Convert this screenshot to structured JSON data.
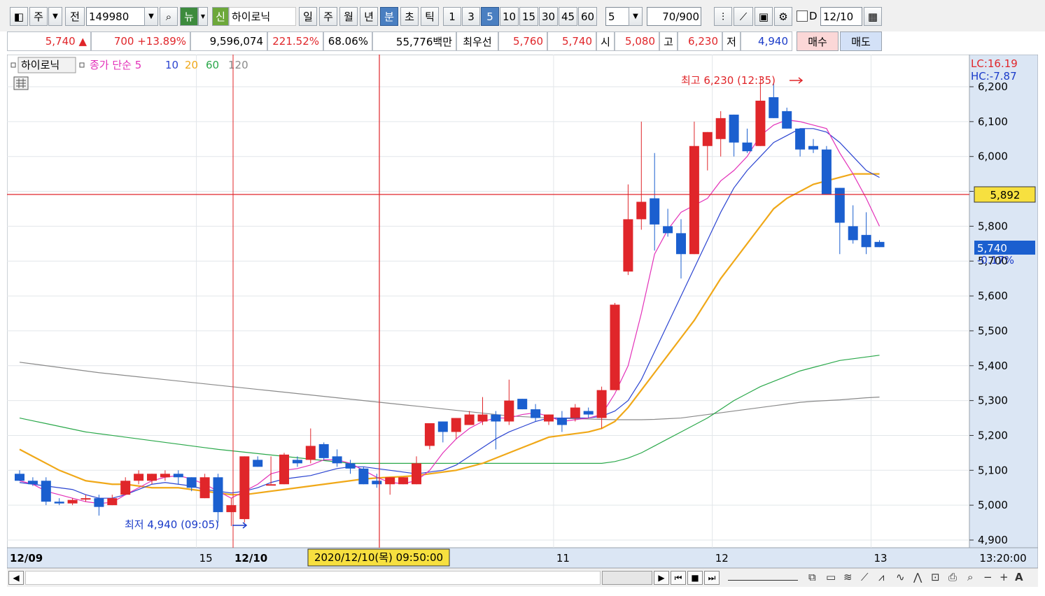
{
  "toolbar": {
    "period_type": "주",
    "prev_label": "전",
    "code": "149980",
    "news_label": "뉴",
    "new_label": "신",
    "stock_name": "하이로닉",
    "periods": [
      "일",
      "주",
      "월",
      "년",
      "분",
      "초",
      "틱"
    ],
    "selected_period": "분",
    "intervals": [
      "1",
      "3",
      "5",
      "10",
      "15",
      "30",
      "45",
      "60"
    ],
    "selected_interval": "5",
    "interval_select": "5",
    "count": "70",
    "count_total": "/900",
    "d_label": "D",
    "date": "12/10"
  },
  "quote": {
    "price": "5,740",
    "change": "700",
    "change_pct": "+13.89%",
    "volume": "9,596,074",
    "vol_ratio": "221.52%",
    "turnover": "68.06%",
    "amount": "55,776백만",
    "best_label": "최우선",
    "ask": "5,760",
    "bid": "5,740",
    "open_label": "시",
    "open": "5,080",
    "high_label": "고",
    "high": "6,230",
    "low_label": "저",
    "low": "4,940",
    "buy_label": "매수",
    "sell_label": "매도"
  },
  "colors": {
    "up": "#e0262a",
    "down": "#1b5fcf",
    "ma5": "#e331b9",
    "ma10": "#2b44d1",
    "ma20": "#f0a818",
    "ma60": "#2aa84a",
    "ma120": "#8a8a8a",
    "crosshair": "#e0262a",
    "right_panel": "#dbe6f4"
  },
  "legend": {
    "name": "하이로닉",
    "ma_label": "종가 단순",
    "periods": [
      "5",
      "10",
      "20",
      "60",
      "120"
    ]
  },
  "right_axis": {
    "lc": "LC:16.19",
    "hc": "HC:-7.87",
    "crosshair_value": "5,892",
    "last_price": "5,740",
    "last_change": "-0.17%"
  },
  "annotations": {
    "high": "최고 6,230 (12:35)",
    "low": "최저 4,940 (09:05)"
  },
  "x_axis": {
    "labels": [
      "12/09",
      "15",
      "12/10",
      "11",
      "12",
      "13"
    ],
    "crosshair_time": "2020/12/10(목) 09:50:00",
    "right_time": "13:20:00"
  },
  "chart_data": {
    "type": "candlestick",
    "ylim": [
      4900,
      6230
    ],
    "yticks": [
      4900,
      5000,
      5100,
      5200,
      5300,
      5400,
      5500,
      5600,
      5700,
      5800,
      5900,
      6000,
      6100,
      6200
    ],
    "ytick_labels": [
      "4,900",
      "5,000",
      "5,100",
      "5,200",
      "5,300",
      "5,400",
      "5,500",
      "5,600",
      "5,700",
      "5,800",
      "5,900",
      "6,000",
      "6,100",
      "6,200"
    ],
    "candles": [
      {
        "o": 5090,
        "h": 5100,
        "l": 5070,
        "c": 5070
      },
      {
        "o": 5070,
        "h": 5080,
        "l": 5055,
        "c": 5060
      },
      {
        "o": 5070,
        "h": 5080,
        "l": 5000,
        "c": 5010
      },
      {
        "o": 5010,
        "h": 5020,
        "l": 5000,
        "c": 5005
      },
      {
        "o": 5005,
        "h": 5020,
        "l": 5000,
        "c": 5015
      },
      {
        "o": 5020,
        "h": 5030,
        "l": 5010,
        "c": 5020
      },
      {
        "o": 5020,
        "h": 5030,
        "l": 4970,
        "c": 4995
      },
      {
        "o": 5000,
        "h": 5030,
        "l": 5000,
        "c": 5020
      },
      {
        "o": 5030,
        "h": 5080,
        "l": 5030,
        "c": 5070
      },
      {
        "o": 5070,
        "h": 5100,
        "l": 5060,
        "c": 5090
      },
      {
        "o": 5070,
        "h": 5090,
        "l": 5060,
        "c": 5090
      },
      {
        "o": 5080,
        "h": 5100,
        "l": 5070,
        "c": 5090
      },
      {
        "o": 5090,
        "h": 5100,
        "l": 5060,
        "c": 5080
      },
      {
        "o": 5080,
        "h": 5080,
        "l": 5040,
        "c": 5050
      },
      {
        "o": 5020,
        "h": 5090,
        "l": 5020,
        "c": 5080
      },
      {
        "o": 5080,
        "h": 5090,
        "l": 4950,
        "c": 4980
      },
      {
        "o": 4980,
        "h": 5020,
        "l": 4940,
        "c": 5000
      },
      {
        "o": 4960,
        "h": 5140,
        "l": 4950,
        "c": 5140
      },
      {
        "o": 5130,
        "h": 5140,
        "l": 5110,
        "c": 5110
      },
      {
        "o": 5060,
        "h": 5140,
        "l": 5060,
        "c": 5060
      },
      {
        "o": 5060,
        "h": 5150,
        "l": 5060,
        "c": 5145
      },
      {
        "o": 5130,
        "h": 5140,
        "l": 5110,
        "c": 5120
      },
      {
        "o": 5130,
        "h": 5220,
        "l": 5120,
        "c": 5170
      },
      {
        "o": 5175,
        "h": 5180,
        "l": 5130,
        "c": 5135
      },
      {
        "o": 5140,
        "h": 5160,
        "l": 5110,
        "c": 5120
      },
      {
        "o": 5120,
        "h": 5130,
        "l": 5090,
        "c": 5105
      },
      {
        "o": 5105,
        "h": 5110,
        "l": 5060,
        "c": 5060
      },
      {
        "o": 5070,
        "h": 5090,
        "l": 5050,
        "c": 5060
      },
      {
        "o": 5060,
        "h": 5070,
        "l": 5030,
        "c": 5080
      },
      {
        "o": 5060,
        "h": 5080,
        "l": 5060,
        "c": 5080
      },
      {
        "o": 5060,
        "h": 5140,
        "l": 5060,
        "c": 5120
      },
      {
        "o": 5170,
        "h": 5200,
        "l": 5160,
        "c": 5235
      },
      {
        "o": 5240,
        "h": 5230,
        "l": 5180,
        "c": 5210
      },
      {
        "o": 5210,
        "h": 5230,
        "l": 5190,
        "c": 5250
      },
      {
        "o": 5230,
        "h": 5270,
        "l": 5230,
        "c": 5260
      },
      {
        "o": 5240,
        "h": 5310,
        "l": 5230,
        "c": 5260
      },
      {
        "o": 5260,
        "h": 5270,
        "l": 5160,
        "c": 5240
      },
      {
        "o": 5240,
        "h": 5360,
        "l": 5230,
        "c": 5300
      },
      {
        "o": 5305,
        "h": 5300,
        "l": 5280,
        "c": 5275
      },
      {
        "o": 5275,
        "h": 5290,
        "l": 5240,
        "c": 5250
      },
      {
        "o": 5240,
        "h": 5260,
        "l": 5230,
        "c": 5260
      },
      {
        "o": 5250,
        "h": 5270,
        "l": 5210,
        "c": 5230
      },
      {
        "o": 5250,
        "h": 5290,
        "l": 5240,
        "c": 5280
      },
      {
        "o": 5270,
        "h": 5280,
        "l": 5250,
        "c": 5260
      },
      {
        "o": 5250,
        "h": 5340,
        "l": 5220,
        "c": 5330
      },
      {
        "o": 5330,
        "h": 5580,
        "l": 5330,
        "c": 5575
      },
      {
        "o": 5670,
        "h": 5920,
        "l": 5660,
        "c": 5820
      },
      {
        "o": 5820,
        "h": 6100,
        "l": 5790,
        "c": 5870
      },
      {
        "o": 5880,
        "h": 6010,
        "l": 5730,
        "c": 5805
      },
      {
        "o": 5800,
        "h": 5850,
        "l": 5770,
        "c": 5780
      },
      {
        "o": 5780,
        "h": 5820,
        "l": 5650,
        "c": 5720
      },
      {
        "o": 5720,
        "h": 6100,
        "l": 5720,
        "c": 6030
      },
      {
        "o": 6030,
        "h": 6070,
        "l": 5960,
        "c": 6070
      },
      {
        "o": 6050,
        "h": 6130,
        "l": 6000,
        "c": 6110
      },
      {
        "o": 6120,
        "h": 6120,
        "l": 6000,
        "c": 6040
      },
      {
        "o": 6040,
        "h": 6080,
        "l": 6010,
        "c": 6015
      },
      {
        "o": 6030,
        "h": 6230,
        "l": 6030,
        "c": 6160
      },
      {
        "o": 6170,
        "h": 6210,
        "l": 6110,
        "c": 6110
      },
      {
        "o": 6130,
        "h": 6140,
        "l": 6080,
        "c": 6080
      },
      {
        "o": 6080,
        "h": 6080,
        "l": 6000,
        "c": 6020
      },
      {
        "o": 6030,
        "h": 6050,
        "l": 6010,
        "c": 6020
      },
      {
        "o": 6020,
        "h": 6030,
        "l": 5890,
        "c": 5890
      },
      {
        "o": 5910,
        "h": 5900,
        "l": 5720,
        "c": 5810
      },
      {
        "o": 5800,
        "h": 5860,
        "l": 5750,
        "c": 5760
      },
      {
        "o": 5775,
        "h": 5840,
        "l": 5720,
        "c": 5740
      },
      {
        "o": 5755,
        "h": 5760,
        "l": 5740,
        "c": 5740
      }
    ],
    "ma5": [
      5070,
      5060,
      5040,
      5030,
      5020,
      5010,
      5005,
      5008,
      5030,
      5050,
      5070,
      5080,
      5085,
      5075,
      5060,
      5040,
      5020,
      5040,
      5060,
      5090,
      5100,
      5105,
      5115,
      5130,
      5130,
      5120,
      5100,
      5080,
      5065,
      5062,
      5070,
      5100,
      5150,
      5190,
      5220,
      5240,
      5250,
      5250,
      5260,
      5265,
      5255,
      5240,
      5245,
      5250,
      5260,
      5320,
      5400,
      5550,
      5720,
      5790,
      5840,
      5860,
      5880,
      5930,
      5960,
      6000,
      6060,
      6090,
      6105,
      6100,
      6090,
      6080,
      6010,
      5950,
      5880,
      5800
    ],
    "ma10": [
      5065,
      5060,
      5055,
      5050,
      5045,
      5030,
      5020,
      5020,
      5030,
      5045,
      5060,
      5065,
      5060,
      5055,
      5045,
      5040,
      5035,
      5040,
      5050,
      5065,
      5075,
      5080,
      5085,
      5095,
      5105,
      5110,
      5110,
      5105,
      5100,
      5095,
      5090,
      5095,
      5100,
      5115,
      5140,
      5165,
      5190,
      5210,
      5225,
      5240,
      5250,
      5250,
      5250,
      5250,
      5255,
      5270,
      5300,
      5360,
      5440,
      5520,
      5600,
      5680,
      5760,
      5840,
      5910,
      5960,
      6000,
      6040,
      6060,
      6080,
      6080,
      6070,
      6040,
      6000,
      5960,
      5940
    ],
    "ma20": [
      5160,
      5140,
      5120,
      5100,
      5085,
      5070,
      5065,
      5060,
      5060,
      5055,
      5050,
      5050,
      5050,
      5045,
      5040,
      5035,
      5030,
      5030,
      5035,
      5040,
      5045,
      5050,
      5055,
      5060,
      5065,
      5070,
      5075,
      5078,
      5080,
      5082,
      5085,
      5090,
      5095,
      5100,
      5110,
      5120,
      5135,
      5150,
      5165,
      5180,
      5195,
      5200,
      5205,
      5210,
      5220,
      5240,
      5280,
      5330,
      5380,
      5430,
      5480,
      5530,
      5590,
      5650,
      5700,
      5750,
      5800,
      5850,
      5880,
      5900,
      5920,
      5930,
      5940,
      5950,
      5950,
      5950
    ],
    "ma60": [
      5250,
      5242,
      5234,
      5226,
      5218,
      5210,
      5205,
      5200,
      5195,
      5190,
      5185,
      5180,
      5175,
      5170,
      5165,
      5160,
      5156,
      5152,
      5148,
      5144,
      5140,
      5136,
      5132,
      5128,
      5124,
      5120,
      5120,
      5120,
      5120,
      5120,
      5120,
      5120,
      5120,
      5120,
      5120,
      5120,
      5120,
      5120,
      5120,
      5120,
      5120,
      5120,
      5120,
      5120,
      5120,
      5125,
      5135,
      5150,
      5170,
      5190,
      5210,
      5230,
      5250,
      5275,
      5300,
      5320,
      5340,
      5355,
      5370,
      5385,
      5395,
      5405,
      5415,
      5420,
      5425,
      5430
    ],
    "ma120": [
      5410,
      5405,
      5400,
      5395,
      5390,
      5385,
      5380,
      5376,
      5372,
      5368,
      5364,
      5360,
      5356,
      5352,
      5348,
      5344,
      5340,
      5336,
      5332,
      5328,
      5324,
      5320,
      5316,
      5312,
      5308,
      5304,
      5300,
      5296,
      5292,
      5288,
      5284,
      5280,
      5276,
      5272,
      5268,
      5264,
      5260,
      5256,
      5254,
      5252,
      5250,
      5249,
      5248,
      5247,
      5246,
      5245,
      5245,
      5245,
      5246,
      5248,
      5250,
      5255,
      5260,
      5265,
      5270,
      5275,
      5280,
      5285,
      5290,
      5295,
      5298,
      5300,
      5302,
      5305,
      5308,
      5310
    ]
  }
}
